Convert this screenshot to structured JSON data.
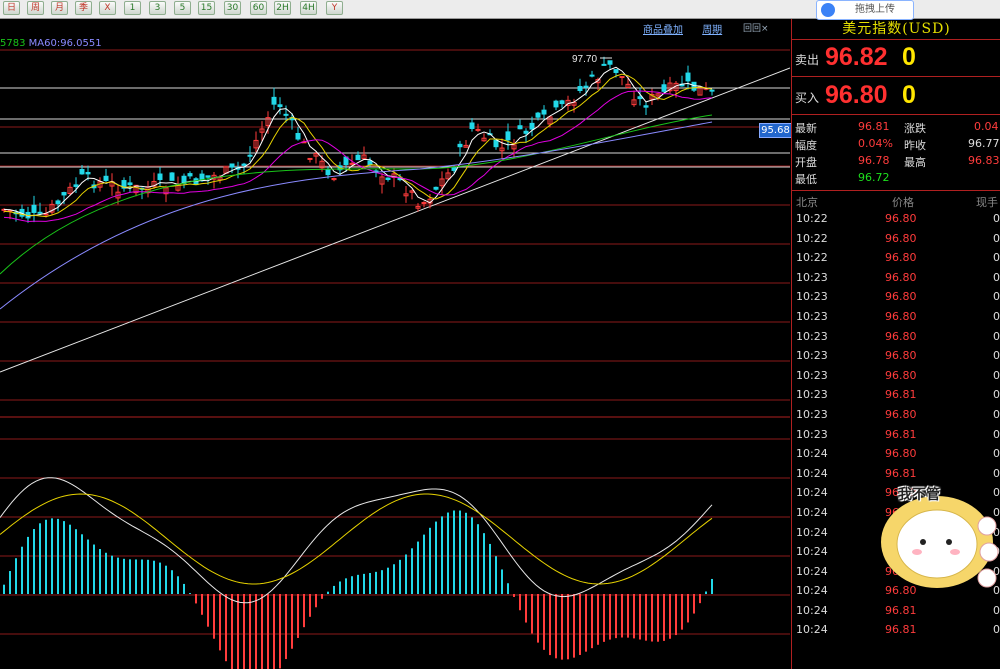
{
  "toolbar": {
    "buttons": [
      "日",
      "周",
      "月",
      "季",
      "X",
      "1",
      "3",
      "5",
      "15",
      "30",
      "60",
      "2H",
      "4H",
      "Y"
    ]
  },
  "chart": {
    "ma_legend_a": "5783",
    "ma_legend_b": "MA60:96.0551",
    "high_label": "97.70",
    "price_tag": "95.68",
    "links": [
      "商品叠加",
      "周期"
    ],
    "window_controls": "回回×"
  },
  "panel": {
    "title": "美元指数(USD)",
    "sell_label": "卖出",
    "sell_price": "96.82",
    "sell_vol": "0",
    "buy_label": "买入",
    "buy_price": "96.80",
    "buy_vol": "0",
    "stats": {
      "latest_label": "最新",
      "latest": "96.81",
      "change_label": "涨跌",
      "change": "0.04",
      "amp_label": "幅度",
      "amp": "0.04%",
      "prev_label": "昨收",
      "prev": "96.77",
      "open_label": "开盘",
      "open": "96.78",
      "high_label": "最高",
      "high": "96.83",
      "low_label": "最低",
      "low": "96.72"
    },
    "tick_headers": {
      "time": "北京",
      "price": "价格",
      "vol": "现手"
    },
    "ticks": [
      {
        "t": "10:22",
        "p": "96.80",
        "v": "0"
      },
      {
        "t": "10:22",
        "p": "96.80",
        "v": "0"
      },
      {
        "t": "10:22",
        "p": "96.80",
        "v": "0"
      },
      {
        "t": "10:23",
        "p": "96.80",
        "v": "0"
      },
      {
        "t": "10:23",
        "p": "96.80",
        "v": "0"
      },
      {
        "t": "10:23",
        "p": "96.80",
        "v": "0"
      },
      {
        "t": "10:23",
        "p": "96.80",
        "v": "0"
      },
      {
        "t": "10:23",
        "p": "96.80",
        "v": "0"
      },
      {
        "t": "10:23",
        "p": "96.80",
        "v": "0"
      },
      {
        "t": "10:23",
        "p": "96.81",
        "v": "0"
      },
      {
        "t": "10:23",
        "p": "96.80",
        "v": "0"
      },
      {
        "t": "10:23",
        "p": "96.81",
        "v": "0"
      },
      {
        "t": "10:24",
        "p": "96.80",
        "v": "0"
      },
      {
        "t": "10:24",
        "p": "96.81",
        "v": "0"
      },
      {
        "t": "10:24",
        "p": "96.80",
        "v": "0"
      },
      {
        "t": "10:24",
        "p": "96.80",
        "v": "0"
      },
      {
        "t": "10:24",
        "p": "96.80",
        "v": "0"
      },
      {
        "t": "10:24",
        "p": "96.80",
        "v": "0"
      },
      {
        "t": "10:24",
        "p": "96.80",
        "v": "0"
      },
      {
        "t": "10:24",
        "p": "96.80",
        "v": "0"
      },
      {
        "t": "10:24",
        "p": "96.81",
        "v": "0"
      },
      {
        "t": "10:24",
        "p": "96.81",
        "v": "0"
      }
    ]
  },
  "overlay": {
    "upload_label": "拖拽上传",
    "sticker_text": "我不管"
  },
  "colors": {
    "up": "#ff3c3c",
    "down": "#22d8e8",
    "grid": "#8b1a1a"
  }
}
